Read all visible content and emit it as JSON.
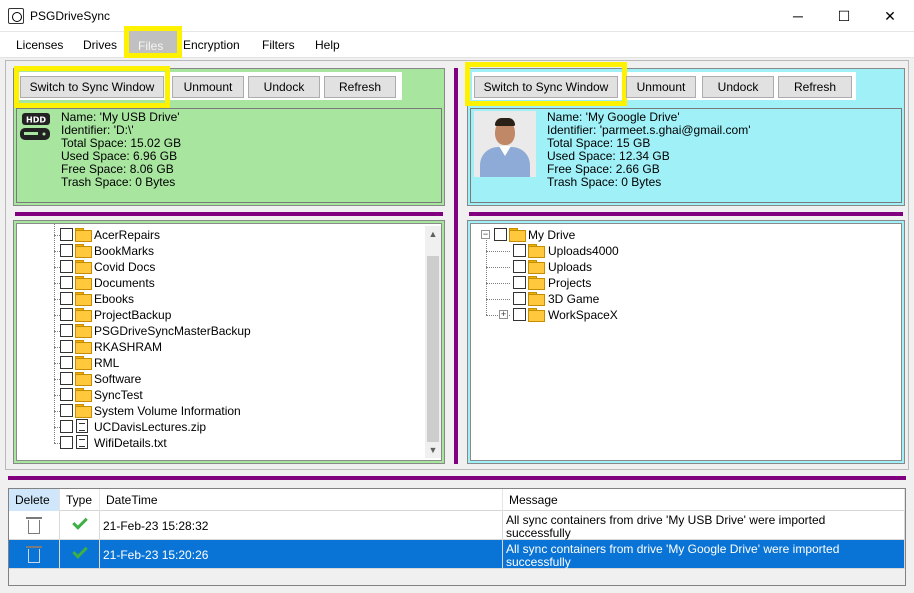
{
  "window": {
    "title": "PSGDriveSync",
    "minimize": "─",
    "maximize": "☐",
    "close": "✕"
  },
  "menu": {
    "licenses": "Licenses",
    "drives": "Drives",
    "files": "Files",
    "encryption": "Encryption",
    "filters": "Filters",
    "help": "Help"
  },
  "left": {
    "toolbar": {
      "switch": "Switch to Sync Window",
      "unmount": "Unmount",
      "undock": "Undock",
      "refresh": "Refresh"
    },
    "drive_icon": "HDD",
    "info": {
      "name": "Name: 'My USB Drive'",
      "identifier": "Identifier: 'D:\\'",
      "total": "Total Space: 15.02 GB",
      "used": "Used Space: 6.96 GB",
      "free": "Free Space: 8.06 GB",
      "trash": "Trash Space: 0 Bytes"
    },
    "panel_color": "#a8e6a0",
    "tree": [
      {
        "label": "AcerRepairs",
        "kind": "folder"
      },
      {
        "label": "BookMarks",
        "kind": "folder"
      },
      {
        "label": "Covid Docs",
        "kind": "folder"
      },
      {
        "label": "Documents",
        "kind": "folder"
      },
      {
        "label": "Ebooks",
        "kind": "folder"
      },
      {
        "label": "ProjectBackup",
        "kind": "folder"
      },
      {
        "label": "PSGDriveSyncMasterBackup",
        "kind": "folder"
      },
      {
        "label": "RKASHRAM",
        "kind": "folder"
      },
      {
        "label": "RML",
        "kind": "folder"
      },
      {
        "label": "Software",
        "kind": "folder"
      },
      {
        "label": "SyncTest",
        "kind": "folder"
      },
      {
        "label": "System Volume Information",
        "kind": "folder"
      },
      {
        "label": "UCDavisLectures.zip",
        "kind": "file"
      },
      {
        "label": "WifiDetails.txt",
        "kind": "file"
      }
    ]
  },
  "right": {
    "toolbar": {
      "switch": "Switch to Sync Window",
      "unmount": "Unmount",
      "undock": "Undock",
      "refresh": "Refresh"
    },
    "info": {
      "name": "Name: 'My Google Drive'",
      "identifier": "Identifier: 'parmeet.s.ghai@gmail.com'",
      "total": "Total Space: 15 GB",
      "used": "Used Space: 12.34 GB",
      "free": "Free Space: 2.66 GB",
      "trash": "Trash Space: 0 Bytes"
    },
    "panel_color": "#a0f0f8",
    "tree": {
      "root": {
        "label": "My Drive",
        "expander": "−"
      },
      "children": [
        {
          "label": "Uploads4000",
          "expander": ""
        },
        {
          "label": "Uploads",
          "expander": ""
        },
        {
          "label": "Projects",
          "expander": ""
        },
        {
          "label": "3D Game",
          "expander": ""
        },
        {
          "label": "WorkSpaceX",
          "expander": "+"
        }
      ]
    }
  },
  "log": {
    "headers": {
      "delete": "Delete",
      "type": "Type",
      "datetime": "DateTime",
      "message": "Message"
    },
    "rows": [
      {
        "datetime": "21-Feb-23 15:28:32",
        "message_line1": "All sync containers from drive 'My USB Drive' were imported",
        "message_line2": "successfully",
        "selected": false
      },
      {
        "datetime": "21-Feb-23 15:20:26",
        "message_line1": "All sync containers from drive 'My Google Drive' were imported",
        "message_line2": "successfully",
        "selected": true
      }
    ],
    "selected_color": "#0a74d6"
  },
  "colors": {
    "highlight": "#fff200",
    "divider": "#800080"
  }
}
